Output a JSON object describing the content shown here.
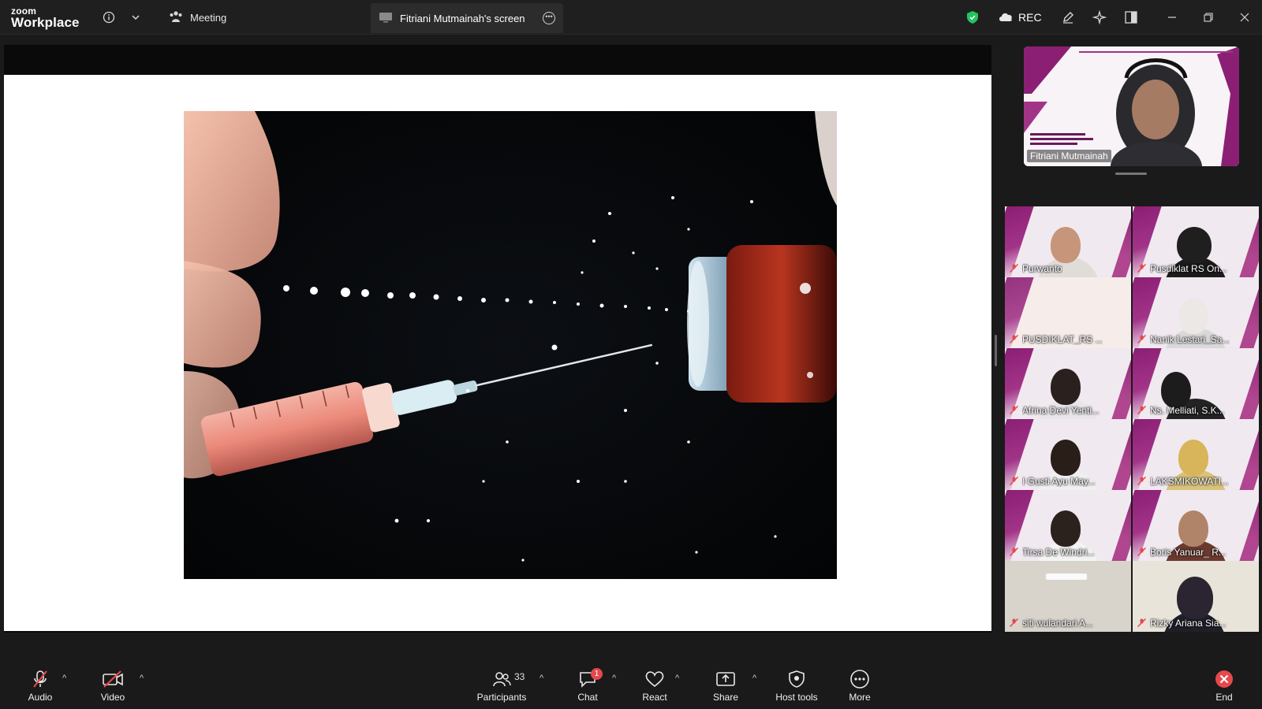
{
  "app": {
    "logo_top": "zoom",
    "logo_bottom": "Workplace",
    "meeting_tab": "Meeting",
    "share_tab": "Fitriani Mutmainah's screen",
    "rec_label": "REC"
  },
  "icons": {
    "info": "info-icon",
    "dropdown": "chevron-down-icon",
    "meeting": "meeting-icon",
    "screen": "screen-share-icon",
    "more": "more-icon",
    "shield": "shield-icon",
    "cloud": "cloud-icon",
    "pen": "pen-icon",
    "sparkle": "sparkle-icon",
    "layout": "layout-icon",
    "minimize": "minimize-icon",
    "restore": "restore-icon",
    "close": "close-icon"
  },
  "colors": {
    "accent_green": "#22c55e",
    "brand_purple": "#8b1f74",
    "mute_red": "#e5484d",
    "end_red": "#e5484d"
  },
  "speaker": {
    "name": "Fitriani Mutmainah"
  },
  "participants": [
    {
      "name": "Purwanto"
    },
    {
      "name": "Pusdiklat RS On..."
    },
    {
      "name": "PUSDIKLAT_RS ..."
    },
    {
      "name": "Nanik Lestari_Sa..."
    },
    {
      "name": "Afrina Devi Yenti..."
    },
    {
      "name": "Ns. Melliati, S.K..."
    },
    {
      "name": "I Gusti Ayu May..."
    },
    {
      "name": "LAKSMIKOWATI..."
    },
    {
      "name": "Tirsa De Windri..."
    },
    {
      "name": "Boris Yanuar_ R..."
    },
    {
      "name": "siti wulandari A..."
    },
    {
      "name": "Rizky Ariana Sia..."
    }
  ],
  "toolbar": {
    "audio": "Audio",
    "video": "Video",
    "participants": "Participants",
    "participants_count": "33",
    "chat": "Chat",
    "chat_badge": "1",
    "react": "React",
    "share": "Share",
    "host_tools": "Host tools",
    "more": "More",
    "end": "End"
  }
}
